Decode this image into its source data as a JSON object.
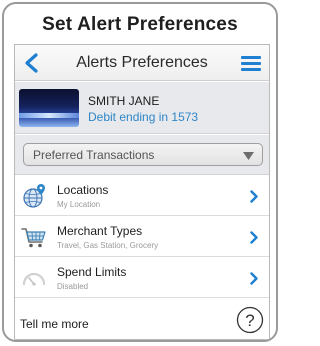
{
  "frame": {
    "title": "Set Alert Preferences"
  },
  "header": {
    "title": "Alerts Preferences",
    "back_icon": "back-chevron-icon",
    "menu_icon": "hamburger-menu-icon"
  },
  "account": {
    "name": "SMITH JANE",
    "description": "Debit ending in 1573"
  },
  "dropdown": {
    "selected": "Preferred Transactions"
  },
  "rows": [
    {
      "title": "Locations",
      "subtitle": "My Location",
      "icon": "globe-pin-icon"
    },
    {
      "title": "Merchant Types",
      "subtitle": "Travel, Gas Station, Grocery",
      "icon": "shopping-cart-icon"
    },
    {
      "title": "Spend Limits",
      "subtitle": "Disabled",
      "icon": "gauge-icon"
    }
  ],
  "footer": {
    "tell_more": "Tell me more",
    "help_icon": "question-mark-icon"
  },
  "colors": {
    "accent": "#1f7fd0",
    "link": "#2f86c8",
    "header_bg": "#eeeeee",
    "panel_bg": "#e7e9ec"
  }
}
